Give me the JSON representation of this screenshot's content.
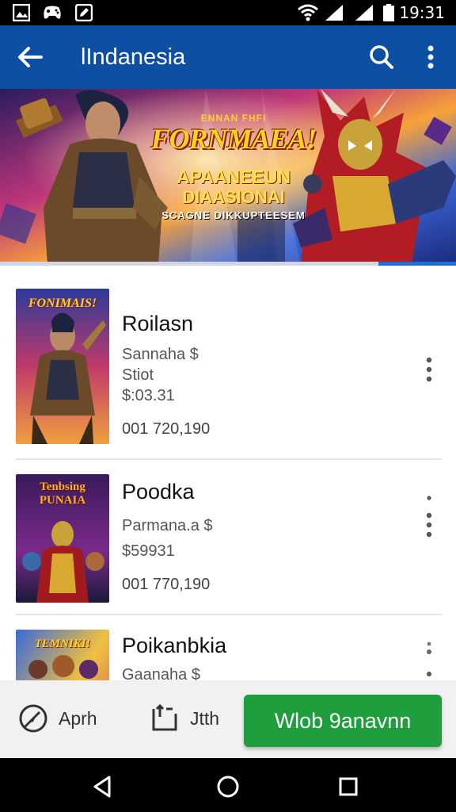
{
  "status_bar": {
    "time": "19:31",
    "icons": [
      "gallery-icon",
      "game-controller-icon",
      "edit-icon",
      "wifi-icon",
      "signal-icon",
      "signal-icon",
      "battery-icon"
    ]
  },
  "app_bar": {
    "title": "lIndanesia",
    "icons": [
      "back-arrow-icon",
      "search-icon",
      "more-vert-icon"
    ]
  },
  "banner": {
    "small_caption": "ENNAN FHFI",
    "title": "FORNMAEA!",
    "line1": "APAANEEUN",
    "line2": "DIAASIONAI",
    "line3": "SCAGNE DIKKUPTEESEM",
    "active_page_fraction": 0.17
  },
  "items": [
    {
      "thumb_caption": "FONIMAIS!",
      "title": "Roilasn",
      "sub1": "Sannaha $",
      "sub2": "Stiot",
      "price": "$:03.31",
      "meta": "001 720,190"
    },
    {
      "thumb_caption": "Tenbsing PUNAIA",
      "title": "Poodka",
      "sub1": "Parmana.a $",
      "price": "$59931",
      "meta": "001 770,190"
    },
    {
      "thumb_caption": "TEMNIKI!",
      "title": "Poikanbkia",
      "sub1": "Gaanaha $"
    }
  ],
  "bottom_bar": {
    "left_label": "Aprh",
    "middle_label": "Jtth",
    "primary_label": "Wlob 9anavnn",
    "primary_color": "#1e9e3c"
  },
  "colors": {
    "app_bar": "#0d4fa3",
    "accent": "#1d6fd6"
  },
  "nav_bar": {
    "icons": [
      "back-triangle-icon",
      "home-circle-icon",
      "recents-square-icon"
    ]
  }
}
